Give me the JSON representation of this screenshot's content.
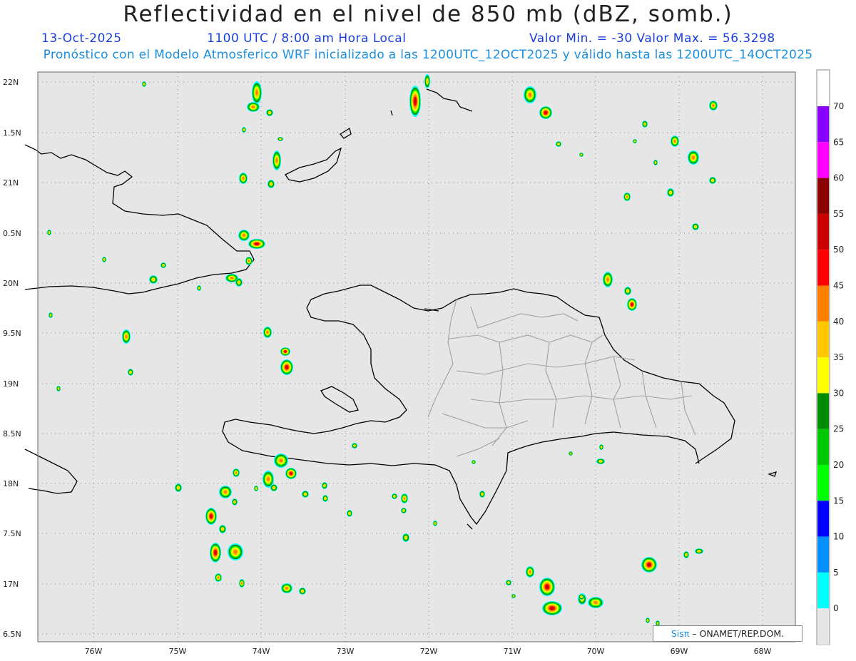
{
  "header": {
    "title": "Reflectividad en el nivel de 850 mb (dBZ, somb.)",
    "date": "13-Oct-2025",
    "time": "1100 UTC / 8:00 am Hora Local",
    "minmax": "Valor Min. = -30  Valor Max. = 56.3298",
    "subtitle": "Pronóstico con el Modelo Atmosferico WRF inicializado a las 1200UTC_12OCT2025 y válido hasta las  1200UTC_14OCT2025"
  },
  "axes": {
    "lon_labels": [
      "76W",
      "75W",
      "74W",
      "73W",
      "72W",
      "71W",
      "70W",
      "69W",
      "68W"
    ],
    "lat_labels": [
      "22N",
      "1.5N",
      "21N",
      "0.5N",
      "20N",
      "9.5N",
      "19N",
      "8.5N",
      "18N",
      "7.5N",
      "17N",
      "6.5N"
    ]
  },
  "colorbar": {
    "labels": [
      "70",
      "65",
      "60",
      "55",
      "50",
      "45",
      "40",
      "35",
      "30",
      "25",
      "20",
      "15",
      "10",
      "5",
      "0"
    ],
    "colors": [
      "#8a00ff",
      "#ff00ff",
      "#8a0000",
      "#c80000",
      "#ff0000",
      "#ff7f00",
      "#ffc800",
      "#ffff00",
      "#008c00",
      "#00c800",
      "#00ff00",
      "#0000ff",
      "#0090ff",
      "#00ffff",
      "#e6e6e6"
    ]
  },
  "credit": {
    "logo": "Sis",
    "pi": "π",
    "text": "– ONAMET/REP.DOM."
  },
  "colors": {
    "background": "#e6e6e6",
    "coast": "#000000",
    "provinces": "#a0a0a0",
    "grid": "#888888"
  }
}
